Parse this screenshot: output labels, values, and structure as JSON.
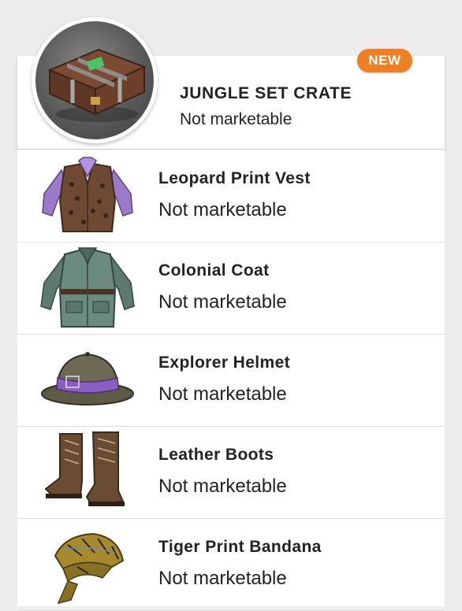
{
  "crate": {
    "title": "JUNGLE SET CRATE",
    "status": "Not marketable",
    "badge": "NEW",
    "icon": "crate-icon"
  },
  "items": [
    {
      "name": "Leopard Print Vest",
      "status": "Not marketable",
      "icon": "vest-icon"
    },
    {
      "name": "Colonial Coat",
      "status": "Not marketable",
      "icon": "coat-icon"
    },
    {
      "name": "Explorer Helmet",
      "status": "Not marketable",
      "icon": "helmet-icon"
    },
    {
      "name": "Leather Boots",
      "status": "Not marketable",
      "icon": "boots-icon"
    },
    {
      "name": "Tiger Print Bandana",
      "status": "Not marketable",
      "icon": "bandana-icon"
    }
  ],
  "colors": {
    "badge": "#ee7f23",
    "background": "#ececec",
    "card": "#ffffff"
  }
}
